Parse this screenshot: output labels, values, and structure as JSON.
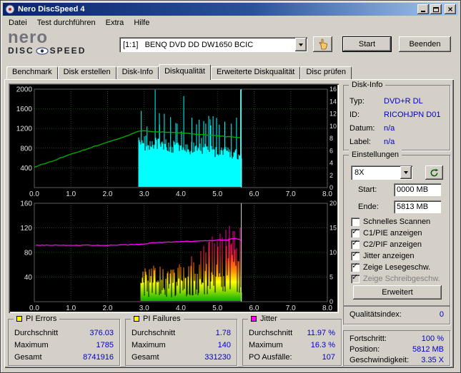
{
  "window": {
    "title": "Nero DiscSpeed 4"
  },
  "menu": {
    "items": [
      "Datei",
      "Test durchführen",
      "Extra",
      "Hilfe"
    ]
  },
  "logo": {
    "name": "nero",
    "disc": "DISC",
    "speed": "SPEED"
  },
  "toolbar": {
    "drive": "[1:1]   BENQ DVD DD DW1650 BCIC",
    "start_label": "Start",
    "quit_label": "Beenden"
  },
  "tabs": [
    {
      "label": "Benchmark",
      "active": false
    },
    {
      "label": "Disk erstellen",
      "active": false
    },
    {
      "label": "Disk-Info",
      "active": false
    },
    {
      "label": "Diskqualität",
      "active": true
    },
    {
      "label": "Erweiterte Diskqualität",
      "active": false
    },
    {
      "label": "Disc prüfen",
      "active": false
    }
  ],
  "disk_info": {
    "caption": "Disk-Info",
    "rows": [
      {
        "label": "Typ:",
        "value": "DVD+R DL"
      },
      {
        "label": "ID:",
        "value": "RICOHJPN D01"
      },
      {
        "label": "Datum:",
        "value": "n/a"
      },
      {
        "label": "Label:",
        "value": "n/a"
      }
    ]
  },
  "settings": {
    "caption": "Einstellungen",
    "speed_value": "8X",
    "start_label": "Start:",
    "start_value": "0000 MB",
    "end_label": "Ende:",
    "end_value": "5813 MB",
    "checkboxes": [
      {
        "label": "Schnelles Scannen",
        "checked": false,
        "disabled": false
      },
      {
        "label": "C1/PIE anzeigen",
        "checked": true,
        "disabled": false
      },
      {
        "label": "C2/PIF anzeigen",
        "checked": true,
        "disabled": false
      },
      {
        "label": "Jitter anzeigen",
        "checked": true,
        "disabled": false
      },
      {
        "label": "Zeige Lesegeschw.",
        "checked": true,
        "disabled": false
      },
      {
        "label": "Zeige Schreibgeschw.",
        "checked": true,
        "disabled": true
      }
    ],
    "advanced_label": "Erweitert"
  },
  "quality": {
    "label": "Qualitätsindex:",
    "value": "0"
  },
  "progress": {
    "rows": [
      {
        "label": "Fortschritt:",
        "value": "100 %"
      },
      {
        "label": "Position:",
        "value": "5812 MB"
      },
      {
        "label": "Geschwindigkeit:",
        "value": "3.35 X"
      }
    ]
  },
  "stats": [
    {
      "caption": "PI Errors",
      "swatch": "#ffff00",
      "rows": [
        [
          "Durchschnitt",
          "376.03"
        ],
        [
          "Maximum",
          "1785"
        ],
        [
          "Gesamt",
          "8741916"
        ]
      ]
    },
    {
      "caption": "PI Failures",
      "swatch": "#ffff00",
      "rows": [
        [
          "Durchschnitt",
          "1.78"
        ],
        [
          "Maximum",
          "140"
        ],
        [
          "Gesamt",
          "331230"
        ]
      ]
    },
    {
      "caption": "Jitter",
      "swatch": "#ff00ff",
      "rows": [
        [
          "Durchschnitt",
          "11.97 %"
        ],
        [
          "Maximum",
          "16.3 %"
        ],
        [
          "PO Ausfälle:",
          "107"
        ]
      ]
    }
  ],
  "colors": {
    "value_text": "#0000cc",
    "pie": "#00ffff",
    "speed_line": "#00a800",
    "jitter": "#ff00ff"
  },
  "chart_data": [
    {
      "type": "area",
      "title": "PI Errors / Lesegeschwindigkeit",
      "x_axis": {
        "max": 8,
        "ticks": [
          [
            0,
            "0.0"
          ],
          [
            1,
            "1.0"
          ],
          [
            2,
            "2.0"
          ],
          [
            3,
            "3.0"
          ],
          [
            4,
            "4.0"
          ],
          [
            5,
            "5.0"
          ],
          [
            6,
            "6.0"
          ],
          [
            7,
            "7.0"
          ],
          [
            8,
            "8.0"
          ]
        ]
      },
      "y_left": {
        "max": 2000,
        "grid": [
          400,
          800,
          1200,
          1600
        ],
        "ticks": [
          [
            2000,
            "2000"
          ],
          [
            1600,
            "1600"
          ],
          [
            1200,
            "1200"
          ],
          [
            800,
            "800"
          ],
          [
            400,
            "400"
          ]
        ]
      },
      "y_right": {
        "max": 16,
        "ticks": [
          [
            16,
            "16"
          ],
          [
            14,
            "14"
          ],
          [
            12,
            "12"
          ],
          [
            10,
            "10"
          ],
          [
            8,
            "8"
          ],
          [
            6,
            "6"
          ],
          [
            4,
            "4"
          ],
          [
            2,
            "2"
          ],
          [
            0,
            "0"
          ]
        ]
      },
      "cursor_x": 5.65,
      "series": [
        {
          "name": "pi-errors",
          "color": "#00ffff",
          "region": [
            2.85,
            5.65
          ],
          "baseline": [
            980,
            720
          ],
          "spikes": [
            [
              2.92,
              1560
            ],
            [
              3.08,
              1240
            ],
            [
              3.3,
              1990
            ],
            [
              3.42,
              1280
            ],
            [
              3.55,
              1500
            ],
            [
              3.72,
              1430
            ],
            [
              3.9,
              1300
            ],
            [
              4.08,
              1860
            ],
            [
              4.3,
              1420
            ],
            [
              4.5,
              1380
            ],
            [
              4.68,
              1300
            ],
            [
              4.88,
              1450
            ],
            [
              5.05,
              1280
            ],
            [
              5.2,
              1340
            ],
            [
              5.38,
              1300
            ],
            [
              5.52,
              1420
            ],
            [
              5.63,
              1990
            ]
          ]
        },
        {
          "name": "lesegeschwindigkeit",
          "color": "#00a800",
          "axis": "right",
          "points": [
            [
              0,
              3.3
            ],
            [
              0.5,
              4.35
            ],
            [
              1,
              5.4
            ],
            [
              1.5,
              6.4
            ],
            [
              2,
              7.4
            ],
            [
              2.5,
              8.35
            ],
            [
              2.9,
              9.25
            ],
            [
              3.3,
              9.1
            ],
            [
              3.8,
              8.95
            ],
            [
              4.3,
              8.75
            ],
            [
              4.8,
              8.5
            ],
            [
              5.2,
              8.3
            ],
            [
              5.65,
              8.05
            ]
          ]
        }
      ]
    },
    {
      "type": "area",
      "title": "PI Failures / Jitter",
      "x_axis": {
        "max": 8,
        "ticks": [
          [
            0,
            "0.0"
          ],
          [
            1,
            "1.0"
          ],
          [
            2,
            "2.0"
          ],
          [
            3,
            "3.0"
          ],
          [
            4,
            "4.0"
          ],
          [
            5,
            "5.0"
          ],
          [
            6,
            "6.0"
          ],
          [
            7,
            "7.0"
          ],
          [
            8,
            "8.0"
          ]
        ]
      },
      "y_left": {
        "max": 160,
        "grid": [
          40,
          80,
          120
        ],
        "ticks": [
          [
            160,
            "160"
          ],
          [
            120,
            "120"
          ],
          [
            80,
            "80"
          ],
          [
            40,
            "40"
          ]
        ]
      },
      "y_right": {
        "max": 20,
        "ticks": [
          [
            20,
            "20"
          ],
          [
            15,
            "15"
          ],
          [
            10,
            "10"
          ],
          [
            5,
            "5"
          ],
          [
            0,
            "0"
          ]
        ]
      },
      "cursor_x": 5.65,
      "series": [
        {
          "name": "pi-failures",
          "region": [
            2.9,
            5.65
          ],
          "envelope": [
            [
              2.9,
              55
            ],
            [
              3.3,
              62
            ],
            [
              3.7,
              58
            ],
            [
              4.0,
              68
            ],
            [
              4.3,
              78
            ],
            [
              4.6,
              92
            ],
            [
              4.9,
              108
            ],
            [
              5.1,
              118
            ],
            [
              5.3,
              128
            ],
            [
              5.5,
              128
            ],
            [
              5.65,
              120
            ]
          ],
          "gradient": [
            [
              0,
              "#00b000"
            ],
            [
              0.1,
              "#86d800"
            ],
            [
              0.2,
              "#ffff00"
            ],
            [
              0.32,
              "#ff8800"
            ],
            [
              0.45,
              "#ff3030"
            ],
            [
              0.6,
              "#ff0078"
            ],
            [
              0.78,
              "#ff00c8"
            ],
            [
              1,
              "#ff60ff"
            ]
          ]
        },
        {
          "name": "jitter",
          "color": "#ff00ff",
          "axis": "right",
          "points": [
            [
              0,
              11.45
            ],
            [
              0.5,
              11.5
            ],
            [
              1,
              11.45
            ],
            [
              1.5,
              11.5
            ],
            [
              2,
              11.45
            ],
            [
              2.5,
              11.55
            ],
            [
              2.9,
              11.65
            ],
            [
              3.2,
              11.95
            ],
            [
              3.6,
              12.1
            ],
            [
              4,
              12.2
            ],
            [
              4.4,
              12.3
            ],
            [
              4.8,
              12.4
            ],
            [
              5.05,
              12.55
            ],
            [
              5.25,
              12.5
            ],
            [
              5.45,
              12.9
            ],
            [
              5.58,
              12.7
            ],
            [
              5.65,
              12.4
            ]
          ]
        }
      ]
    }
  ]
}
